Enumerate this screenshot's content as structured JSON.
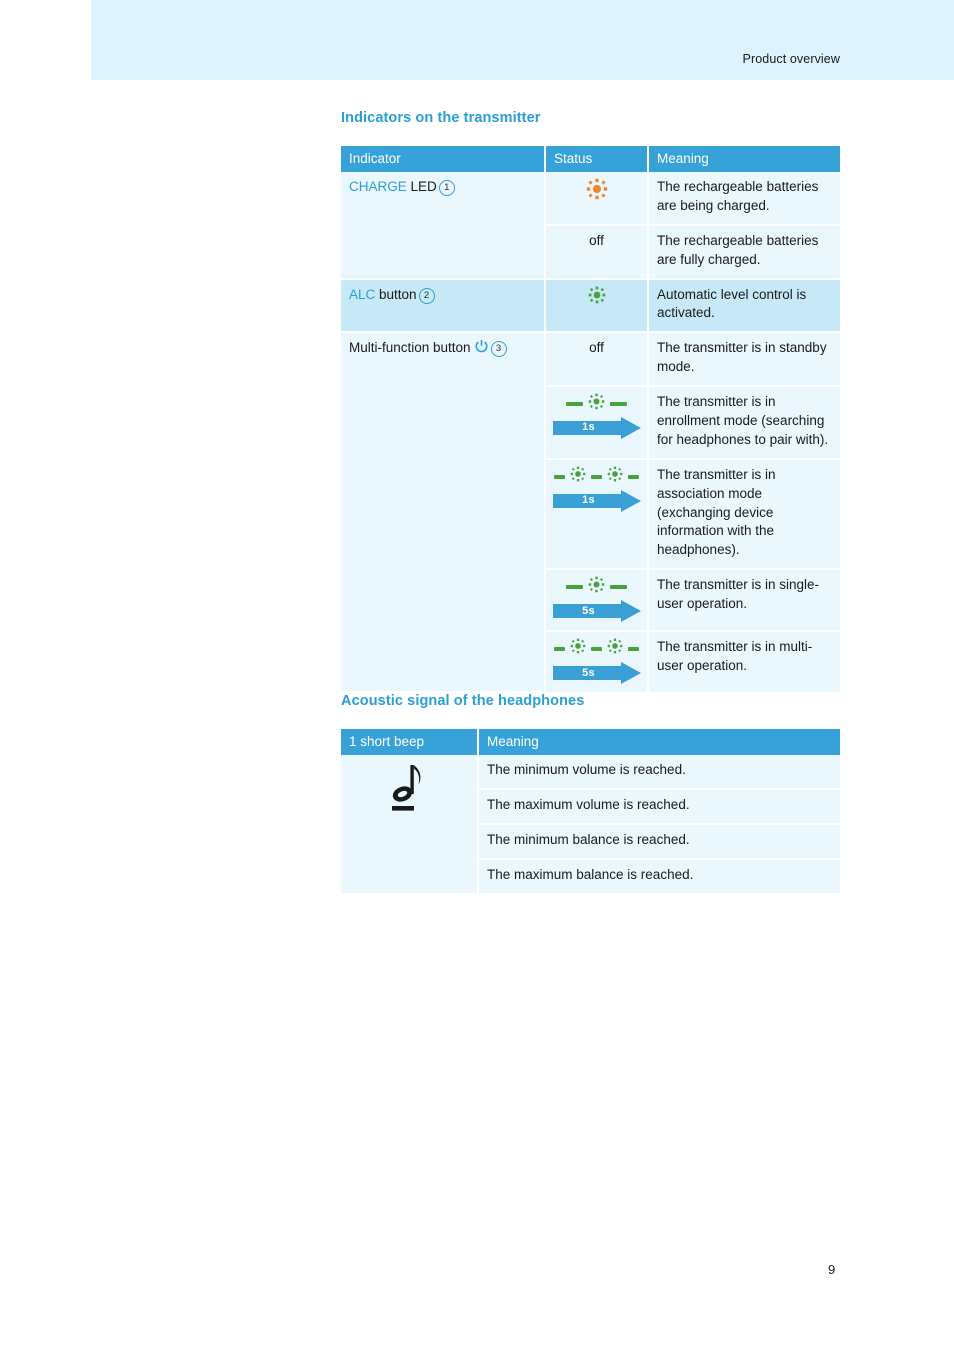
{
  "page": {
    "header_title": "Product overview",
    "page_number": "9",
    "accent_blue": "#2a9fd4",
    "table_header_blue": "#36a2d8",
    "row_light": "#eaf7fd",
    "row_dark": "#c7e8f7",
    "header_band": "#ddf3fd",
    "led_orange": "#f0892c",
    "led_green": "#4aa23c",
    "arrow_blue": "#3a9fd4"
  },
  "indicators_section": {
    "heading": "Indicators on the transmitter",
    "columns": [
      "Indicator",
      "Status",
      "Meaning"
    ],
    "rows": [
      {
        "indicator_prefix": "CHARGE",
        "indicator_rest": " LED",
        "indicator_number": "1",
        "indicator_icon": "",
        "status_type": "led",
        "status_icon": "led-orange-icon",
        "status_text": "",
        "meaning": "The rechargeable batteries are being charged."
      },
      {
        "indicator_prefix": "",
        "indicator_rest": "",
        "indicator_number": "",
        "indicator_icon": "",
        "status_type": "text",
        "status_icon": "",
        "status_text": "off",
        "meaning": "The rechargeable batteries are fully charged."
      },
      {
        "indicator_prefix": "ALC",
        "indicator_rest": " button",
        "indicator_number": "2",
        "indicator_icon": "",
        "status_type": "led",
        "status_icon": "led-green-icon",
        "status_text": "",
        "meaning": "Automatic level control is activated."
      },
      {
        "indicator_prefix": "",
        "indicator_rest": "Multi-function button",
        "indicator_number": "3",
        "indicator_icon": "power-icon",
        "status_type": "text",
        "status_icon": "",
        "status_text": "off",
        "meaning": "The transmitter is in standby mode."
      },
      {
        "indicator_prefix": "",
        "indicator_rest": "",
        "indicator_number": "",
        "indicator_icon": "",
        "status_type": "blink",
        "blink_pattern": "dash-led-dash",
        "blink_leds": 1,
        "arrow_label": "1s",
        "meaning": "The transmitter is in enrollment mode (searching for headphones to pair with)."
      },
      {
        "indicator_prefix": "",
        "indicator_rest": "",
        "indicator_number": "",
        "indicator_icon": "",
        "status_type": "blink",
        "blink_pattern": "dash-led-dash-led-dash",
        "blink_leds": 2,
        "arrow_label": "1s",
        "meaning": "The transmitter is in association mode (exchanging device information with the headphones)."
      },
      {
        "indicator_prefix": "",
        "indicator_rest": "",
        "indicator_number": "",
        "indicator_icon": "",
        "status_type": "blink",
        "blink_pattern": "dash-led-dash",
        "blink_leds": 1,
        "arrow_label": "5s",
        "meaning": "The transmitter is in single-user operation."
      },
      {
        "indicator_prefix": "",
        "indicator_rest": "",
        "indicator_number": "",
        "indicator_icon": "",
        "status_type": "blink",
        "blink_pattern": "dash-led-dash-led-dash",
        "blink_leds": 2,
        "arrow_label": "5s",
        "meaning": "The transmitter is in multi-user operation."
      }
    ]
  },
  "acoustic_section": {
    "heading": "Acoustic signal of the headphones",
    "columns": [
      "1 short beep",
      "Meaning"
    ],
    "beep_icon": "eighth-note-icon",
    "rows": [
      {
        "meaning": "The minimum volume is reached."
      },
      {
        "meaning": "The maximum volume is reached."
      },
      {
        "meaning": "The minimum balance is reached."
      },
      {
        "meaning": "The maximum balance is reached."
      }
    ]
  }
}
